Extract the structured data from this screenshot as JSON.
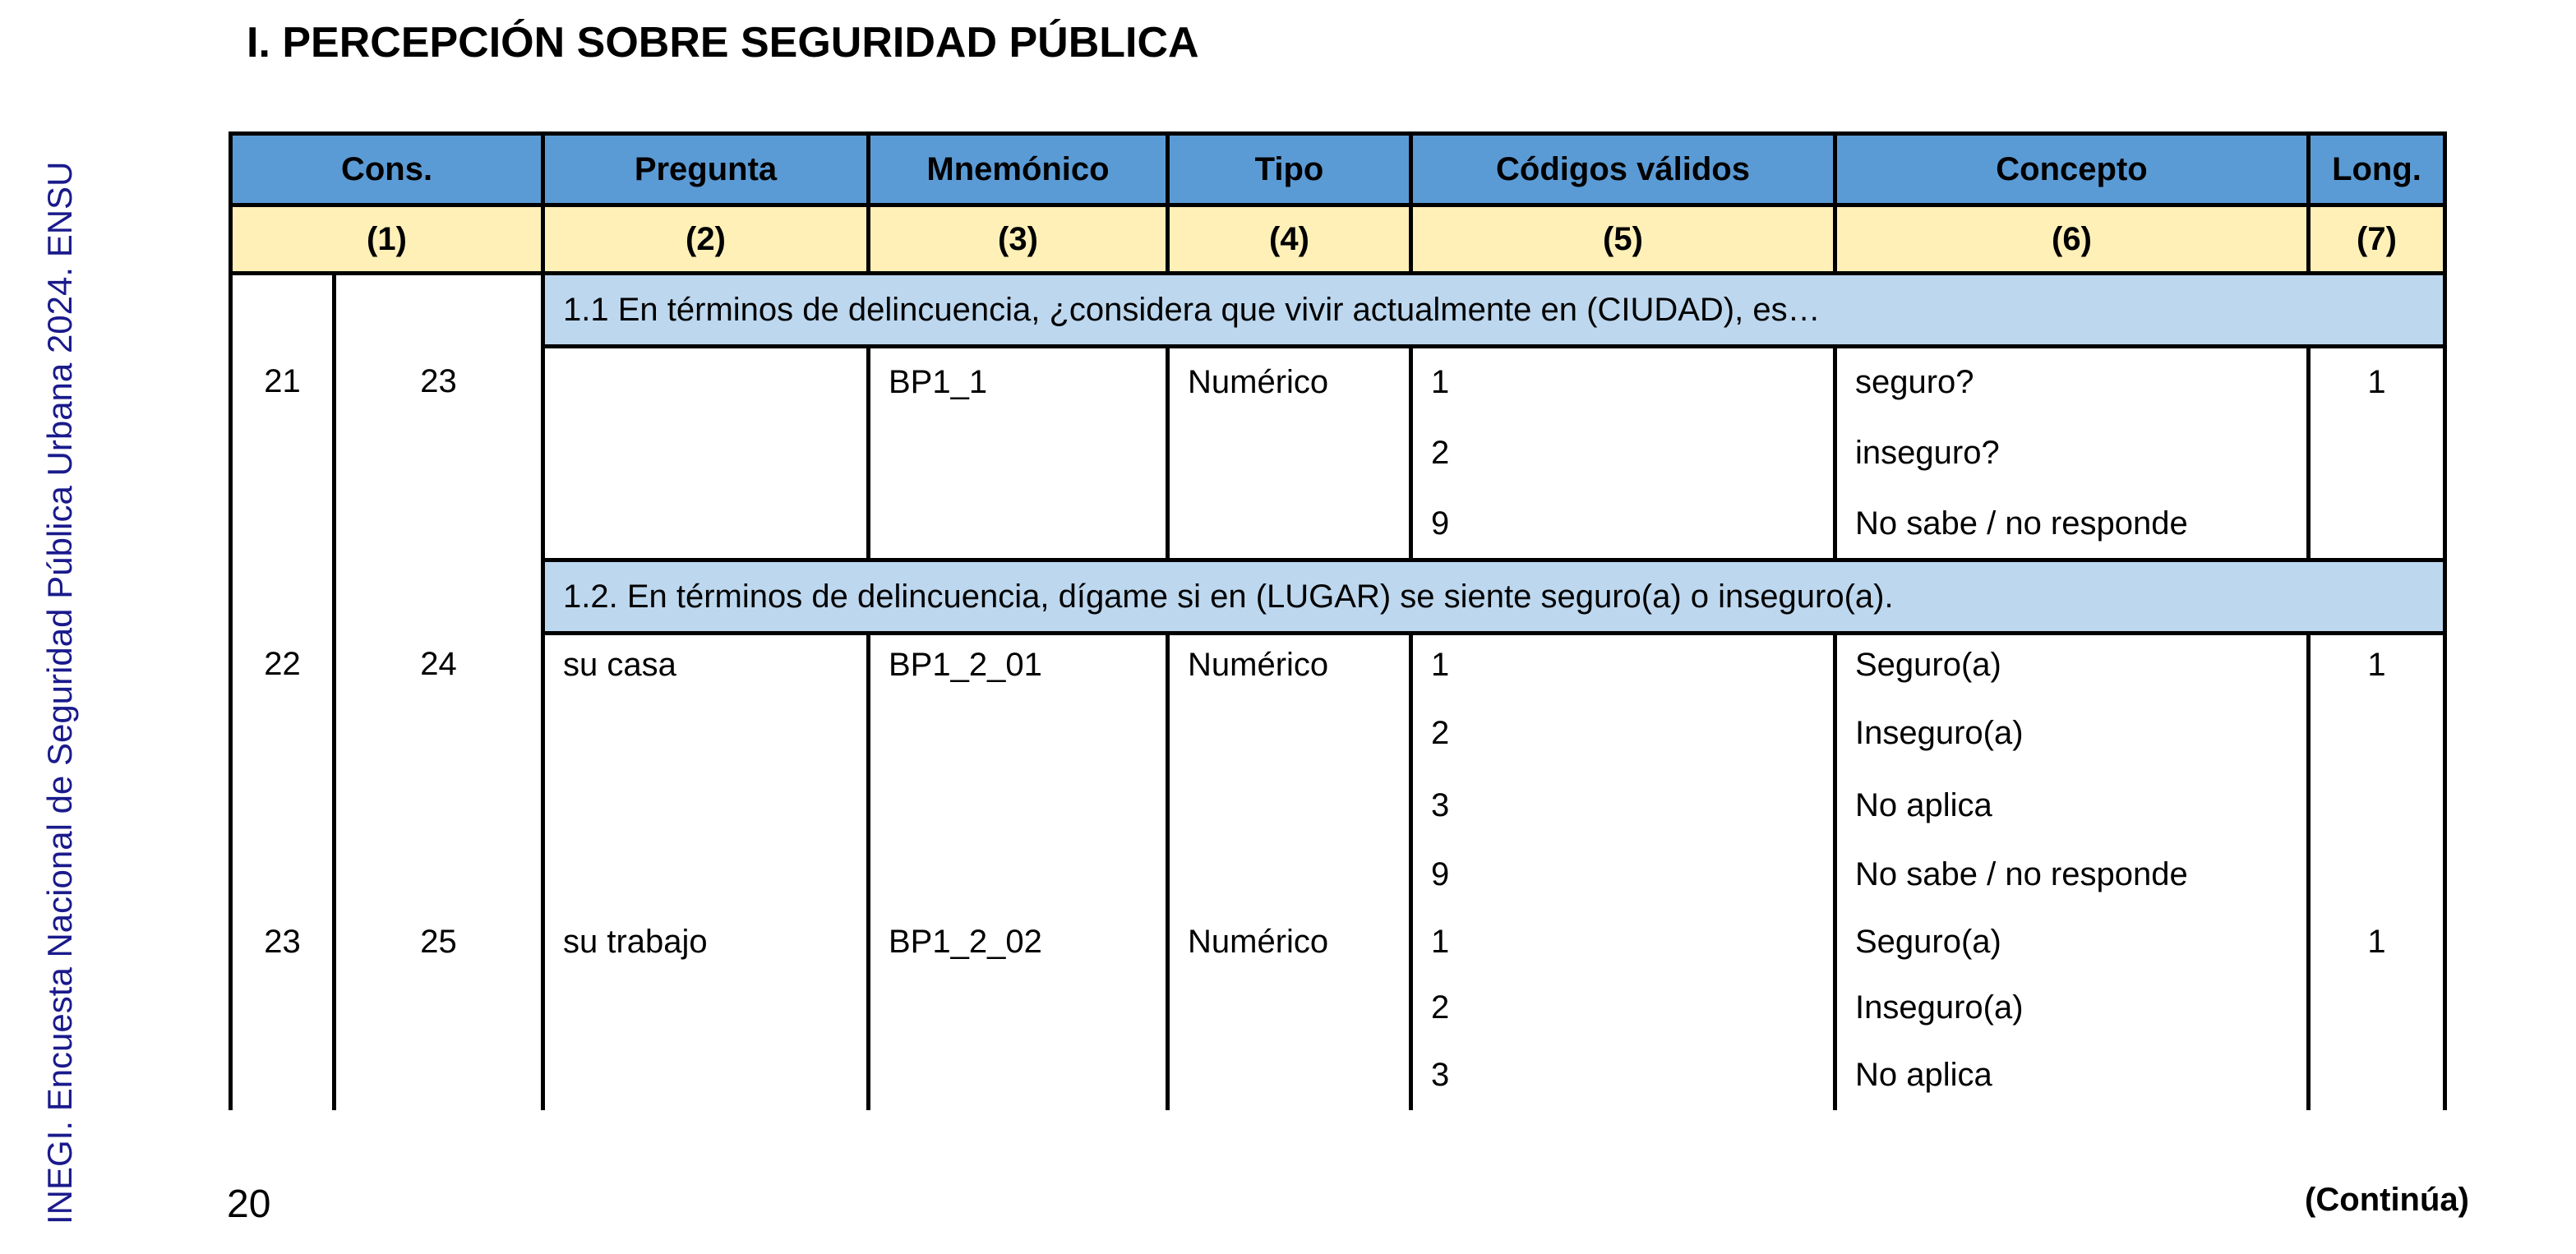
{
  "side_text": "INEGI. Encuesta Nacional de Seguridad Pública Urbana 2024. ENSU",
  "section_title": "I. PERCEPCIÓN SOBRE SEGURIDAD PÚBLICA",
  "page_number": "20",
  "continua": "(Continúa)",
  "headers": [
    "Cons.",
    "Pregunta",
    "Mnemónico",
    "Tipo",
    "Códigos válidos",
    "Concepto",
    "Long."
  ],
  "header_numbers": [
    "(1)",
    "(2)",
    "(3)",
    "(4)",
    "(5)",
    "(6)",
    "(7)"
  ],
  "q1": {
    "text": "1.1 En términos de delincuencia, ¿considera que vivir actualmente en (CIUDAD), es…",
    "rows": [
      {
        "c1": "21",
        "c2": "23",
        "pregunta": "",
        "mnemonico": "BP1_1",
        "tipo": "Numérico",
        "codigo": "1",
        "concepto": "seguro?",
        "long": "1"
      },
      {
        "codigo": "2",
        "concepto": "inseguro?"
      },
      {
        "codigo": "9",
        "concepto": "No sabe / no responde"
      }
    ]
  },
  "q2": {
    "text": "1.2. En términos de delincuencia, dígame si en (LUGAR) se siente seguro(a) o inseguro(a).",
    "rows": [
      {
        "c1": "22",
        "c2": "24",
        "pregunta": "su casa",
        "mnemonico": "BP1_2_01",
        "tipo": "Numérico",
        "codigo": "1",
        "concepto": "Seguro(a)",
        "long": "1"
      },
      {
        "codigo": "2",
        "concepto": "Inseguro(a)"
      },
      {
        "codigo": "3",
        "concepto": "No aplica"
      },
      {
        "codigo": "9",
        "concepto": "No sabe / no responde"
      },
      {
        "c1": "23",
        "c2": "25",
        "pregunta": "su trabajo",
        "mnemonico": "BP1_2_02",
        "tipo": "Numérico",
        "codigo": "1",
        "concepto": "Seguro(a)",
        "long": "1"
      },
      {
        "codigo": "2",
        "concepto": "Inseguro(a)"
      },
      {
        "codigo": "3",
        "concepto": "No aplica"
      }
    ]
  }
}
